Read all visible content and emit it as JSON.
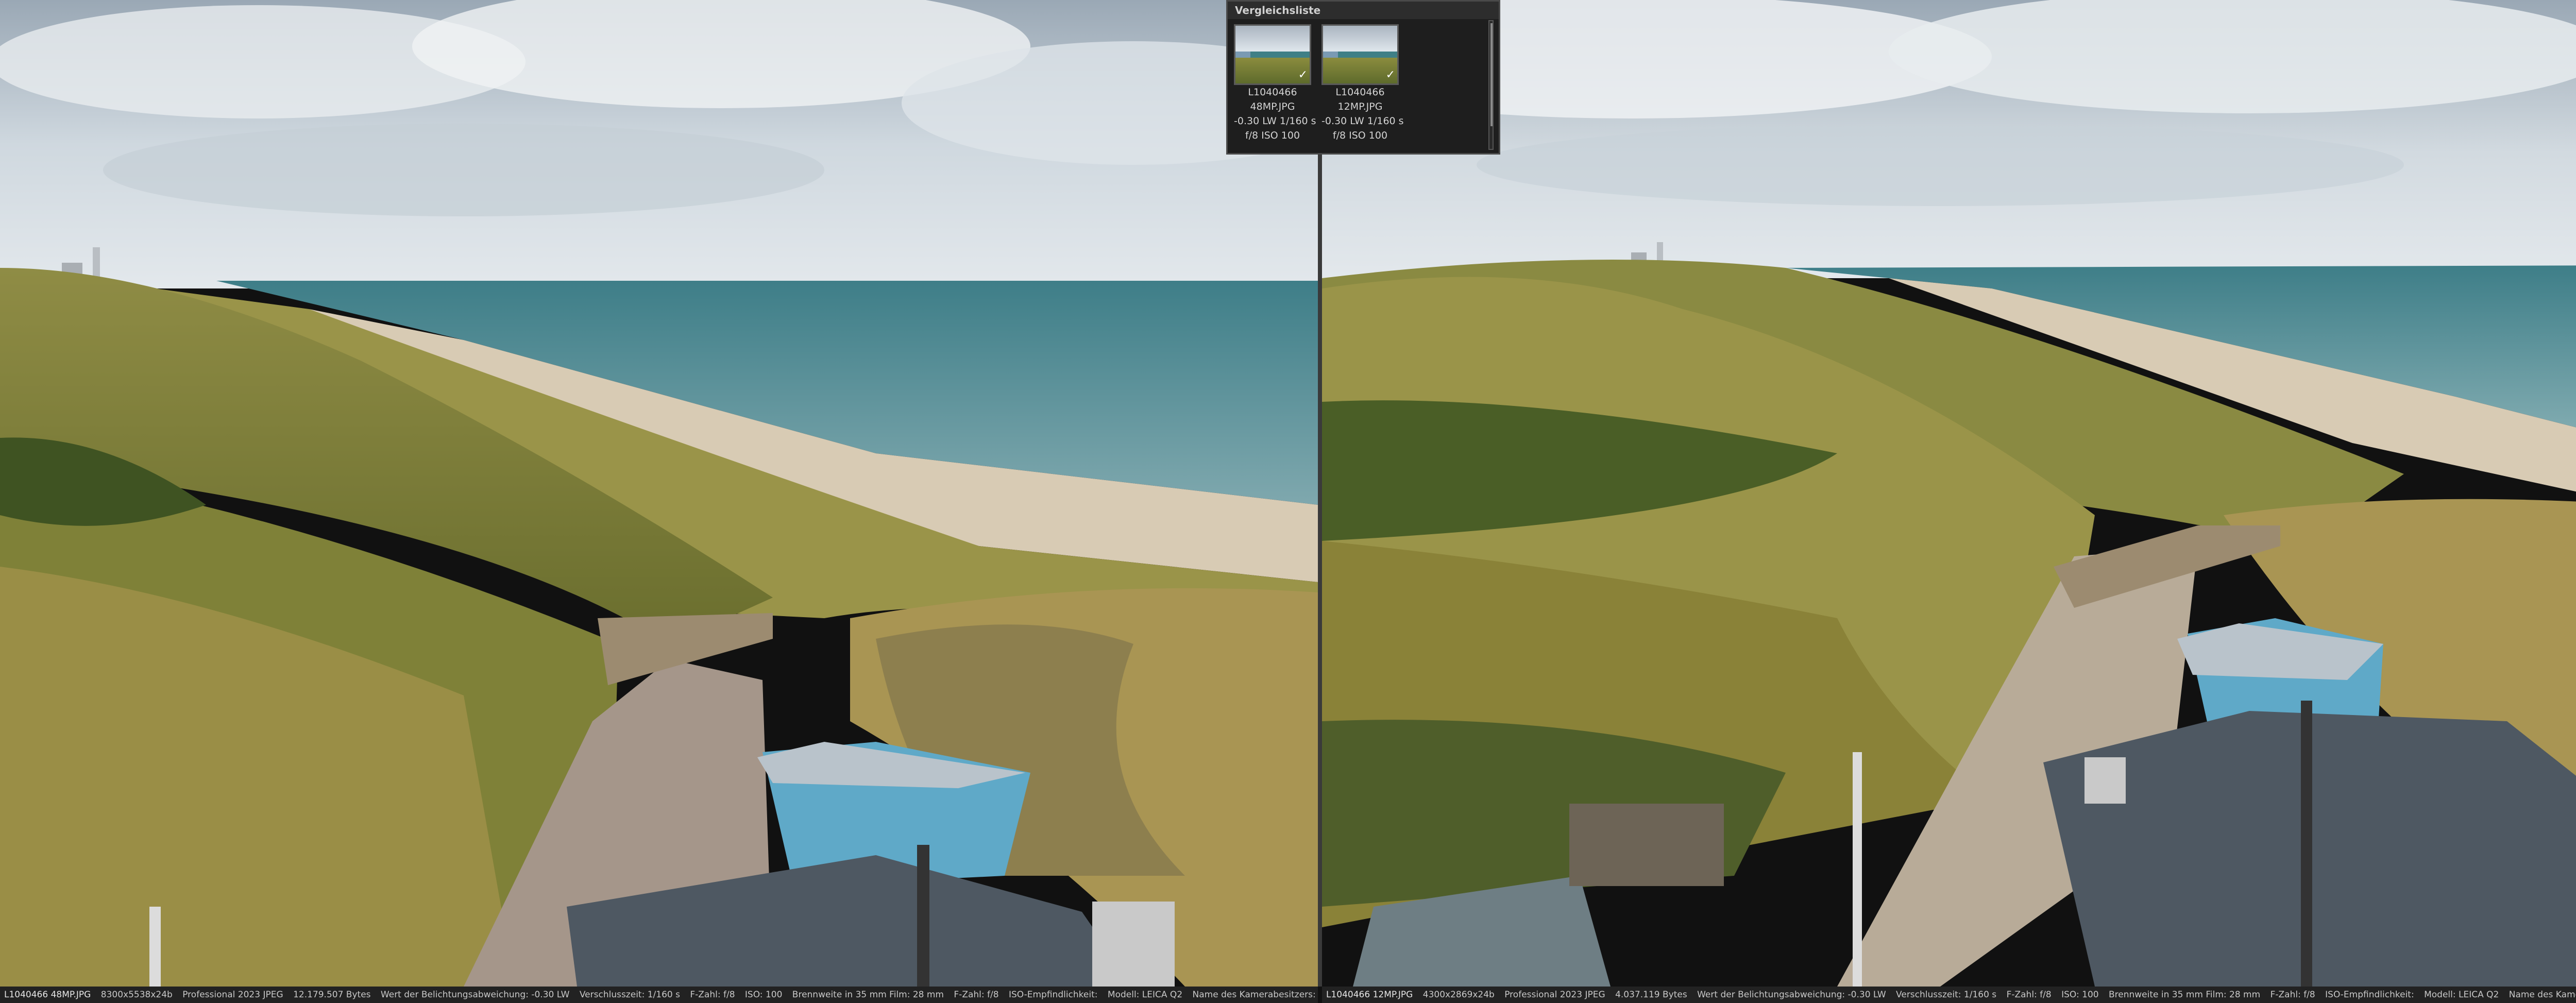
{
  "compare_panel": {
    "title": "Vergleichsliste",
    "items": [
      {
        "name": "L1040466",
        "format": "48MP.JPG",
        "exposure": "-0.30 LW",
        "shutter": "1/160 s",
        "aperture": "f/8",
        "iso": "ISO 100",
        "checked": true
      },
      {
        "name": "L1040466",
        "format": "12MP.JPG",
        "exposure": "-0.30 LW",
        "shutter": "1/160 s",
        "aperture": "f/8",
        "iso": "ISO 100",
        "checked": true
      }
    ],
    "check_glyph": "✓"
  },
  "status_left": {
    "file": "L1040466 48MP.JPG",
    "dims": "8300x5538x24b",
    "app": "Professional 2023 JPEG",
    "size": "12.179.507 Bytes",
    "exposure": "Wert der Belichtungsabweichung: -0.30 LW",
    "shutter": "Verschlusszeit: 1/160 s",
    "fnum": "F-Zahl: f/8",
    "iso": "ISO: 100",
    "focal": "Brennweite in 35 mm Film: 28 mm",
    "fnum2": "F-Zahl: f/8",
    "iso2": "ISO-Empfindlichkeit:",
    "model": "Modell: LEICA Q2",
    "owner": "Name des Kamerabesitzers:"
  },
  "status_right": {
    "file": "L1040466 12MP.JPG",
    "dims": "4300x2869x24b",
    "app": "Professional 2023 JPEG",
    "size": "4.037.119 Bytes",
    "exposure": "Wert der Belichtungsabweichung: -0.30 LW",
    "shutter": "Verschlusszeit: 1/160 s",
    "fnum": "F-Zahl: f/8",
    "iso": "ISO: 100",
    "focal": "Brennweite in 35 mm Film: 28 mm",
    "fnum2": "F-Zahl: f/8",
    "iso2": "ISO-Empfindlichkeit:",
    "model": "Modell: LEICA Q2",
    "owner": "Name des Kamerabesitzers:"
  },
  "colors": {
    "sky": "#c9d3dc",
    "sea": "#3d7d86",
    "sand": "#cbbca6",
    "dune": "#8f8a3e",
    "roof": "#4e5862",
    "hut": "#5fa9c8"
  }
}
